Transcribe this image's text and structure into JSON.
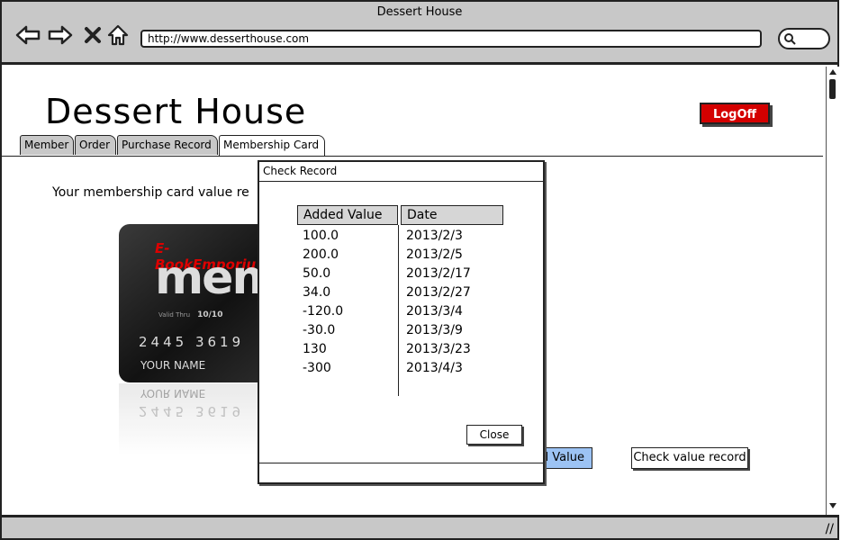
{
  "browser": {
    "window_title": "Dessert House",
    "url": "http://www.desserthouse.com"
  },
  "site": {
    "title": "Dessert House",
    "logoff_label": "LogOff"
  },
  "tabs": [
    {
      "label": "Member"
    },
    {
      "label": "Order"
    },
    {
      "label": "Purchase Record"
    },
    {
      "label": "Membership Card",
      "active": true
    }
  ],
  "main": {
    "card_value_text": "Your membership card value re",
    "add_value_label": "d Value",
    "check_value_label": "Check value record"
  },
  "card": {
    "brand": "E-BookEmporiu",
    "big_text": "mem",
    "valid_thru_label": "Valid Thru",
    "valid_thru": "10/10",
    "number": "2445 3619",
    "name": "YOUR NAME"
  },
  "dialog": {
    "title": "Check Record",
    "columns": [
      "Added Value",
      "Date"
    ],
    "rows": [
      {
        "value": "100.0",
        "date": "2013/2/3"
      },
      {
        "value": "200.0",
        "date": "2013/2/5"
      },
      {
        "value": "50.0",
        "date": "2013/2/17"
      },
      {
        "value": "34.0",
        "date": "2013/2/27"
      },
      {
        "value": "-120.0",
        "date": "2013/3/4"
      },
      {
        "value": "-30.0",
        "date": "2013/3/9"
      },
      {
        "value": "130",
        "date": "2013/3/23"
      },
      {
        "value": "-300",
        "date": "2013/4/3"
      }
    ],
    "close_label": "Close"
  },
  "colors": {
    "logoff_bg": "#d40000",
    "add_value_bg": "#9cc3f4",
    "chrome_bg": "#c8c8c8"
  }
}
